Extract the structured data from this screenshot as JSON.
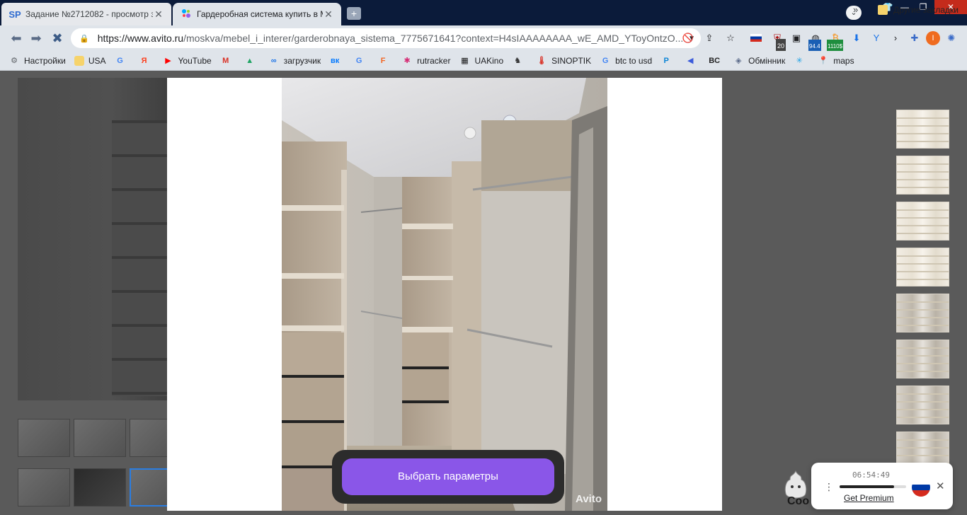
{
  "tabs": [
    {
      "label": "Задание №2712082 - просмотр з",
      "favicon": "SP"
    },
    {
      "label": "Гардеробная система купить в М",
      "favicon": "avito-icon"
    }
  ],
  "address": {
    "host": "https://www.avito.ru",
    "path": "/moskva/mebel_i_interer/garderobnaya_sistema_7775671641?context=H4sIAAAAAAAA_wE_AMD_YToyOntzO..."
  },
  "extensions": {
    "badge_20": "20",
    "badge_944": "94.4",
    "badge_1110": "1110$"
  },
  "bookmarks": [
    {
      "label": "Настройки",
      "icon": "gear-icon",
      "color": "#5f6368",
      "glyph": "⚙"
    },
    {
      "label": "USA",
      "icon": "folder-icon",
      "color": "#f6d36b",
      "glyph": ""
    },
    {
      "label": "",
      "icon": "google-icon",
      "color": "#4285f4",
      "glyph": "G"
    },
    {
      "label": "",
      "icon": "yandex-icon",
      "color": "#fc3f1d",
      "glyph": "Я"
    },
    {
      "label": "YouTube",
      "icon": "youtube-icon",
      "color": "#ff0000",
      "glyph": "▶"
    },
    {
      "label": "",
      "icon": "gmail-icon",
      "color": "#d93025",
      "glyph": "M"
    },
    {
      "label": "",
      "icon": "drive-icon",
      "color": "#1fa463",
      "glyph": "▲"
    },
    {
      "label": "загрузчик",
      "icon": "infinity-icon",
      "color": "#1a73e8",
      "glyph": "∞"
    },
    {
      "label": "",
      "icon": "vk-icon",
      "color": "#0077ff",
      "glyph": "вк"
    },
    {
      "label": "",
      "icon": "translate-icon",
      "color": "#4285f4",
      "glyph": "G"
    },
    {
      "label": "",
      "icon": "f-icon",
      "color": "#f26522",
      "glyph": "F"
    },
    {
      "label": "rutracker",
      "icon": "rutracker-icon",
      "color": "#d62d75",
      "glyph": "✱"
    },
    {
      "label": "UAKino",
      "icon": "uakino-icon",
      "color": "#111111",
      "glyph": "▦"
    },
    {
      "label": "",
      "icon": "chess-icon",
      "color": "#333333",
      "glyph": "♞"
    },
    {
      "label": "SINOPTIK",
      "icon": "thermometer-icon",
      "color": "#d93025",
      "glyph": "🌡"
    },
    {
      "label": "btc to usd",
      "icon": "google-icon",
      "color": "#4285f4",
      "glyph": "G"
    },
    {
      "label": "",
      "icon": "p-icon",
      "color": "#0a84d6",
      "glyph": "P"
    },
    {
      "label": "",
      "icon": "arrow-icon",
      "color": "#3b5bdb",
      "glyph": "◀"
    },
    {
      "label": "",
      "icon": "bc-icon",
      "color": "#222222",
      "glyph": "BC"
    },
    {
      "label": "Обмінник",
      "icon": "exchange-icon",
      "color": "#5c6b8a",
      "glyph": "◈"
    },
    {
      "label": "",
      "icon": "snowflake-icon",
      "color": "#1aa0e6",
      "glyph": "✳"
    },
    {
      "label": "maps",
      "icon": "maps-icon",
      "color": "#34a853",
      "glyph": "📍"
    }
  ],
  "bookmarks_more": "»",
  "other_bookmarks": "Другие закладки",
  "modal": {
    "cta_label": "Выбрать параметры",
    "watermark": "Avito"
  },
  "widget": {
    "time": "06:54:49",
    "progress": 0.82,
    "premium": "Get Premium",
    "partial_text": "Coo"
  }
}
